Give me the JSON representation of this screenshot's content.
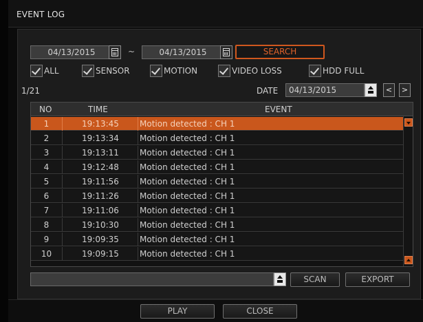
{
  "window": {
    "title": "EVENT LOG"
  },
  "search": {
    "from_date": "04/13/2015",
    "separator": "~",
    "to_date": "04/13/2015",
    "search_label": "SEARCH",
    "accent": "#d0581e"
  },
  "filters": [
    {
      "label": "ALL",
      "checked": true
    },
    {
      "label": "SENSOR",
      "checked": true
    },
    {
      "label": "MOTION",
      "checked": true
    },
    {
      "label": "VIDEO LOSS",
      "checked": true
    },
    {
      "label": "HDD FULL",
      "checked": true
    }
  ],
  "paging": {
    "page": "1/21",
    "date_label": "DATE",
    "date_value": "04/13/2015",
    "prev_icon": "chevron-left-icon",
    "next_icon": "chevron-right-icon"
  },
  "table": {
    "headers": [
      "NO",
      "TIME",
      "EVENT"
    ],
    "rows": [
      {
        "no": "1",
        "time": "19:13:45",
        "event": "Motion detected : CH 1",
        "selected": true
      },
      {
        "no": "2",
        "time": "19:13:34",
        "event": "Motion detected : CH 1"
      },
      {
        "no": "3",
        "time": "19:13:11",
        "event": "Motion detected : CH 1"
      },
      {
        "no": "4",
        "time": "19:12:48",
        "event": "Motion detected : CH 1"
      },
      {
        "no": "5",
        "time": "19:11:56",
        "event": "Motion detected : CH 1"
      },
      {
        "no": "6",
        "time": "19:11:26",
        "event": "Motion detected : CH 1"
      },
      {
        "no": "7",
        "time": "19:11:06",
        "event": "Motion detected : CH 1"
      },
      {
        "no": "8",
        "time": "19:10:30",
        "event": "Motion detected : CH 1"
      },
      {
        "no": "9",
        "time": "19:09:35",
        "event": "Motion detected : CH 1"
      },
      {
        "no": "10",
        "time": "19:09:15",
        "event": "Motion detected : CH 1"
      }
    ],
    "selected_color": "#c9571c"
  },
  "export": {
    "path_value": "",
    "scan_label": "SCAN",
    "export_label": "EXPORT"
  },
  "footer": {
    "play_label": "PLAY",
    "close_label": "CLOSE"
  }
}
